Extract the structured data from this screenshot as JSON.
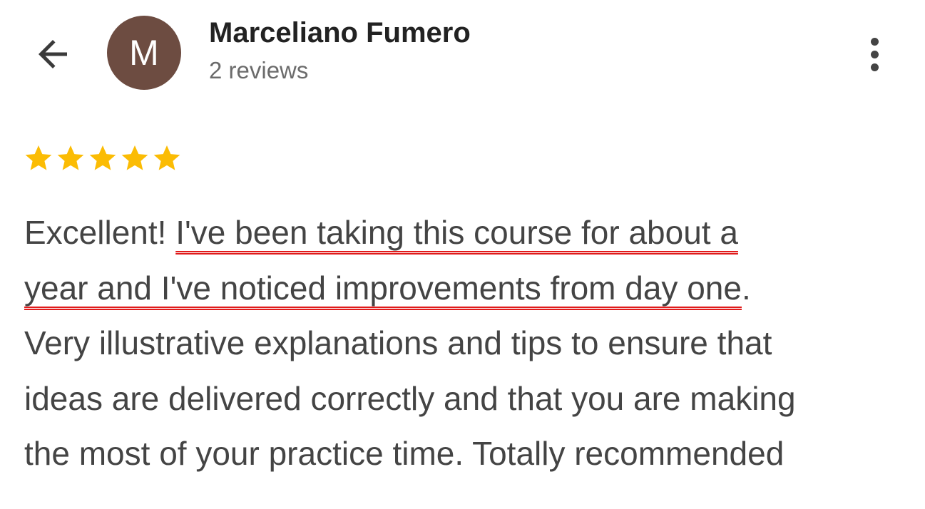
{
  "header": {
    "back_icon": "arrow-left-icon",
    "avatar_letter": "M",
    "avatar_color": "#6d4c41",
    "user_name": "Marceliano Fumero",
    "review_count": "2 reviews",
    "more_icon": "more-vertical-icon"
  },
  "review": {
    "rating": 5,
    "max_rating": 5,
    "star_color": "#fbbc04",
    "underline_color": "#e01b1b",
    "lines": [
      {
        "segments": [
          {
            "text": "Excellent! ",
            "highlight": false
          },
          {
            "text": "I've been taking this course for about a",
            "highlight": true
          }
        ]
      },
      {
        "segments": [
          {
            "text": "year and I've noticed improvements from day one",
            "highlight": true
          },
          {
            "text": ".",
            "highlight": false
          }
        ]
      },
      {
        "segments": [
          {
            "text": "Very illustrative explanations and tips to ensure that",
            "highlight": false
          }
        ]
      },
      {
        "segments": [
          {
            "text": "ideas are delivered correctly and that you are making",
            "highlight": false
          }
        ]
      },
      {
        "segments": [
          {
            "text": "the most of your practice time. Totally recommended",
            "highlight": false
          }
        ]
      }
    ]
  }
}
